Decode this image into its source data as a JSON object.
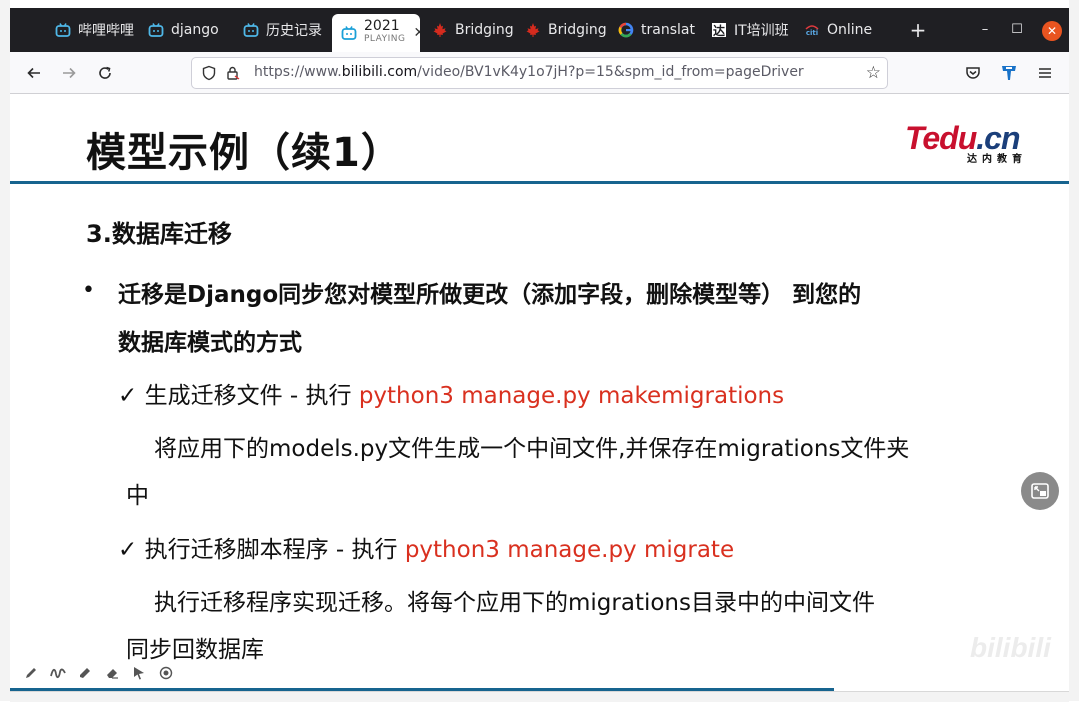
{
  "browser": {
    "tabs": [
      {
        "label": "哔哩哔哩",
        "icon": "bilibili-icon"
      },
      {
        "label": "django",
        "icon": "bilibili-icon"
      },
      {
        "label": "历史记录",
        "icon": "bilibili-icon"
      },
      {
        "label": "2021",
        "sub": "PLAYING",
        "icon": "bilibili-icon",
        "active": true
      },
      {
        "label": "Bridging",
        "icon": "maple-leaf-icon"
      },
      {
        "label": "Bridging",
        "icon": "maple-leaf-icon"
      },
      {
        "label": "translat",
        "icon": "google-icon"
      },
      {
        "label": "IT培训班",
        "icon": "tarena-icon"
      },
      {
        "label": "Online",
        "icon": "citi-icon"
      }
    ],
    "new_tab": "+",
    "window_controls": {
      "minimize": "–",
      "maximize": "☐",
      "close": "✕"
    },
    "url_prefix": "https://www.",
    "url_domain": "bilibili.com",
    "url_rest": "/video/BV1vK4y1o7jH?p=15&spm_id_from=pageDriver"
  },
  "slide": {
    "title": "模型示例（续1）",
    "logo_main_1": "Tedu",
    "logo_main_2": ".cn",
    "logo_sub": "达内教育",
    "section": "3.数据库迁移",
    "bullet_line1": "迁移是Django同步您对模型所做更改（添加字段，删除模型等） 到您的",
    "bullet_line2": "数据库模式的方式",
    "check1_label": "生成迁移文件 - 执行 ",
    "check1_cmd": "python3 manage.py makemigrations",
    "check1_desc1": "将应用下的models.py文件生成一个中间文件,并保存在migrations文件夹",
    "check1_desc2": "中",
    "check2_label": "执行迁移脚本程序 - 执行 ",
    "check2_cmd": "python3 manage.py migrate",
    "check2_desc1": "执行迁移程序实现迁移。将每个应用下的migrations目录中的中间文件",
    "check2_desc2": "同步回数据库",
    "check_mark": "✓",
    "bullet_mark": "•",
    "watermark": "bilibili"
  },
  "colors": {
    "accent_rule": "#17648f",
    "command_red": "#d9301f",
    "tab_bar": "#1f1f23",
    "close_orange": "#e95420"
  }
}
